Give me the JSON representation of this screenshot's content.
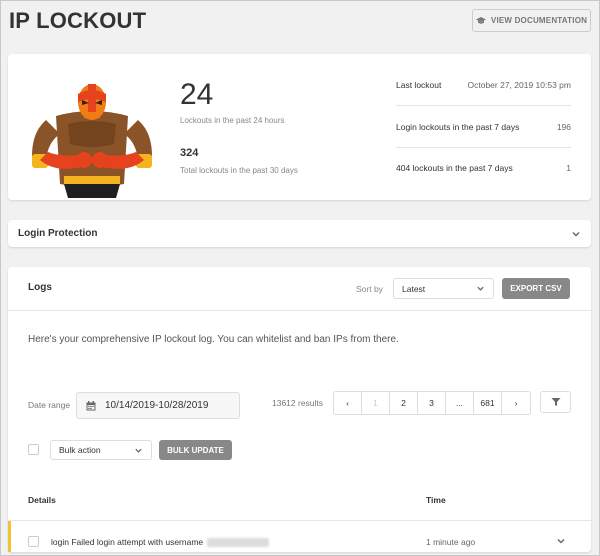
{
  "header": {
    "title": "IP LOCKOUT",
    "view_documentation_label": "VIEW DOCUMENTATION"
  },
  "summary": {
    "lockouts_24h": "24",
    "lockouts_24h_label": "Lockouts in the past 24 hours",
    "lockouts_30d": "324",
    "lockouts_30d_label": "Total lockouts in the past 30 days",
    "stats": [
      {
        "label": "Last lockout",
        "value": "October 27, 2019 10:53 pm"
      },
      {
        "label": "Login lockouts in the past 7 days",
        "value": "196"
      },
      {
        "label": "404 lockouts in the past 7 days",
        "value": "1"
      }
    ]
  },
  "login_protection": {
    "title": "Login Protection"
  },
  "logs": {
    "title": "Logs",
    "sort_label": "Sort by",
    "sort_value": "Latest",
    "export_label": "EXPORT CSV",
    "intro": "Here's your comprehensive IP lockout log. You can whitelist and ban IPs from there.",
    "date_range_label": "Date range",
    "date_range_value": "10/14/2019-10/28/2019",
    "results": "13612 results",
    "pagination": {
      "prev": "‹",
      "pages": [
        "1",
        "2",
        "3",
        "...",
        "681"
      ],
      "next": "›"
    },
    "bulk_action_label": "Bulk action",
    "bulk_update_label": "BULK UPDATE",
    "columns": {
      "details": "Details",
      "time": "Time"
    },
    "rows": [
      {
        "detail": "login Failed login attempt with username",
        "time": "1 minute ago"
      }
    ]
  },
  "colors": {
    "accent_yellow": "#f1c232",
    "button_gray": "#888888",
    "background": "#f1f1f1"
  },
  "icons": [
    "graduation-cap-icon",
    "chevron-down-icon",
    "calendar-icon",
    "filter-icon"
  ]
}
